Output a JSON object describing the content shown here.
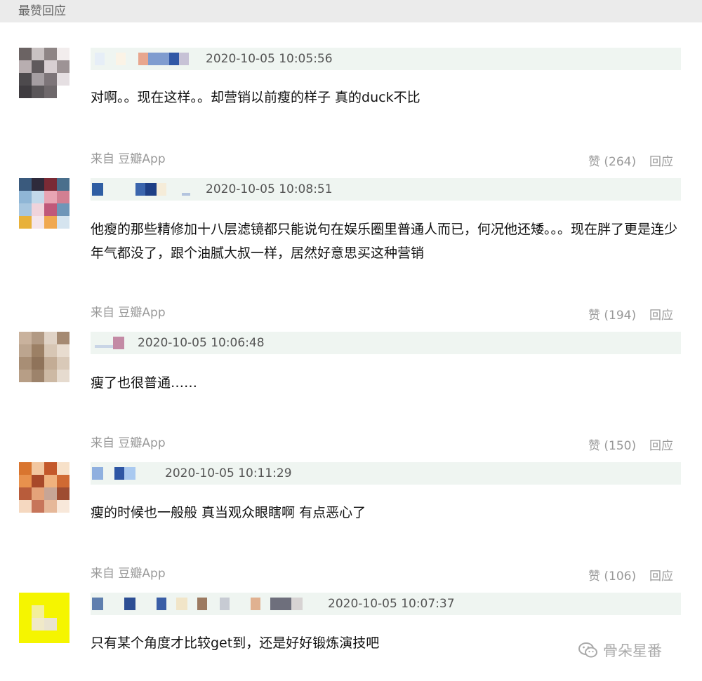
{
  "section_title": "最赞回应",
  "comments": [
    {
      "timestamp": "2020-10-05 10:05:56",
      "text": "对啊。。现在这样。。却营销以前瘦的样子 真的duck不比",
      "source": "来自 豆瓣App",
      "like_label": "赞 (264)",
      "reply_label": "回应"
    },
    {
      "timestamp": "2020-10-05 10:08:51",
      "text": "他瘦的那些精修加十八层滤镜都只能说句在娱乐圈里普通人而已，何况他还矮。。。现在胖了更是连少年气都没了，跟个油腻大叔一样，居然好意思买这种营销",
      "source": "来自 豆瓣App",
      "like_label": "赞 (194)",
      "reply_label": "回应"
    },
    {
      "timestamp": "2020-10-05 10:06:48",
      "text": "瘦了也很普通……",
      "source": "来自 豆瓣App",
      "like_label": "赞 (150)",
      "reply_label": "回应"
    },
    {
      "timestamp": "2020-10-05 10:11:29",
      "text": "瘦的时候也一般般 真当观众眼瞎啊 有点恶心了",
      "source": "来自 豆瓣App",
      "like_label": "赞 (106)",
      "reply_label": "回应"
    },
    {
      "timestamp": "2020-10-05 10:07:37",
      "text": "只有某个角度才比较get到，还是好好锻炼演技吧"
    }
  ],
  "watermark": "骨朵星番",
  "colors": {
    "meta_bar": "#eff5f1",
    "header_bg": "#ebebeb",
    "muted_text": "#999999"
  }
}
